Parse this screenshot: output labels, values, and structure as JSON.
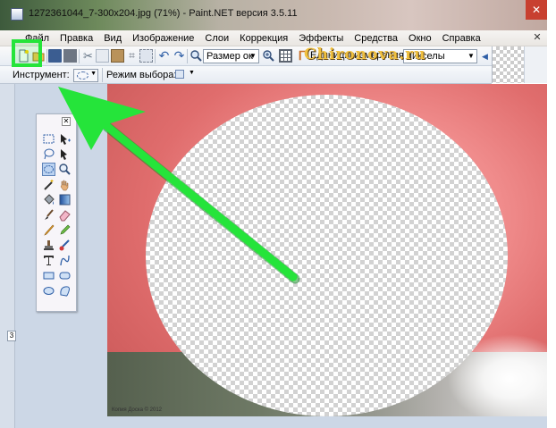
{
  "window": {
    "title": "1272361044_7-300x204.jpg (71%) - Paint.NET версия 3.5.11",
    "close_glyph": "✕"
  },
  "menu": {
    "items": [
      "Файл",
      "Правка",
      "Вид",
      "Изображение",
      "Слои",
      "Коррекция",
      "Эффекты",
      "Средства",
      "Окно",
      "Справка"
    ],
    "close_glyph": "✕"
  },
  "toolbar": {
    "icons": [
      "new-image-icon",
      "open-icon",
      "save-icon",
      "print-icon",
      "cut-icon",
      "copy-icon",
      "paste-icon",
      "crop-icon",
      "deselect-icon",
      "undo-icon",
      "redo-icon",
      "zoom-out-icon",
      "zoom-in-icon",
      "grid-icon",
      "ruler-icon"
    ],
    "zoom_value": "Размер ок",
    "units_label": "Единицы измерения:",
    "units_value": "пикселы",
    "dropdown_glyph": "▼",
    "cut_glyph": "✂",
    "crop_glyph": "⌗",
    "undo_glyph": "↶",
    "redo_glyph": "↷",
    "zoom_glyph": "🔍",
    "ruler_glyph": "ᒥ",
    "scroll_left_glyph": "◀"
  },
  "tool_options": {
    "tool_label": "Инструмент:",
    "mode_label": "Режим выбора:"
  },
  "watermark": "Chironova.ru",
  "canvas": {
    "credit": "Копия Доска © 2012"
  },
  "tools_window": {
    "close_glyph": "✕",
    "tools": [
      "rectangle-select-icon",
      "move-selection-icon",
      "lasso-select-icon",
      "move-selected-icon",
      "ellipse-select-icon",
      "zoom-icon",
      "magic-wand-icon",
      "pan-icon",
      "paint-bucket-icon",
      "gradient-icon",
      "paintbrush-icon",
      "eraser-icon",
      "pencil-icon",
      "color-picker-icon",
      "clone-stamp-icon",
      "recolor-icon",
      "text-icon",
      "line-curve-icon",
      "rectangle-icon",
      "rounded-rectangle-icon",
      "ellipse-icon",
      "freeform-shape-icon"
    ],
    "selected_tool": "ellipse-select-icon"
  },
  "colors": {
    "highlight": "#25e43a",
    "canvas_pink": "#f08c8c",
    "watermark": "#f0c040"
  }
}
